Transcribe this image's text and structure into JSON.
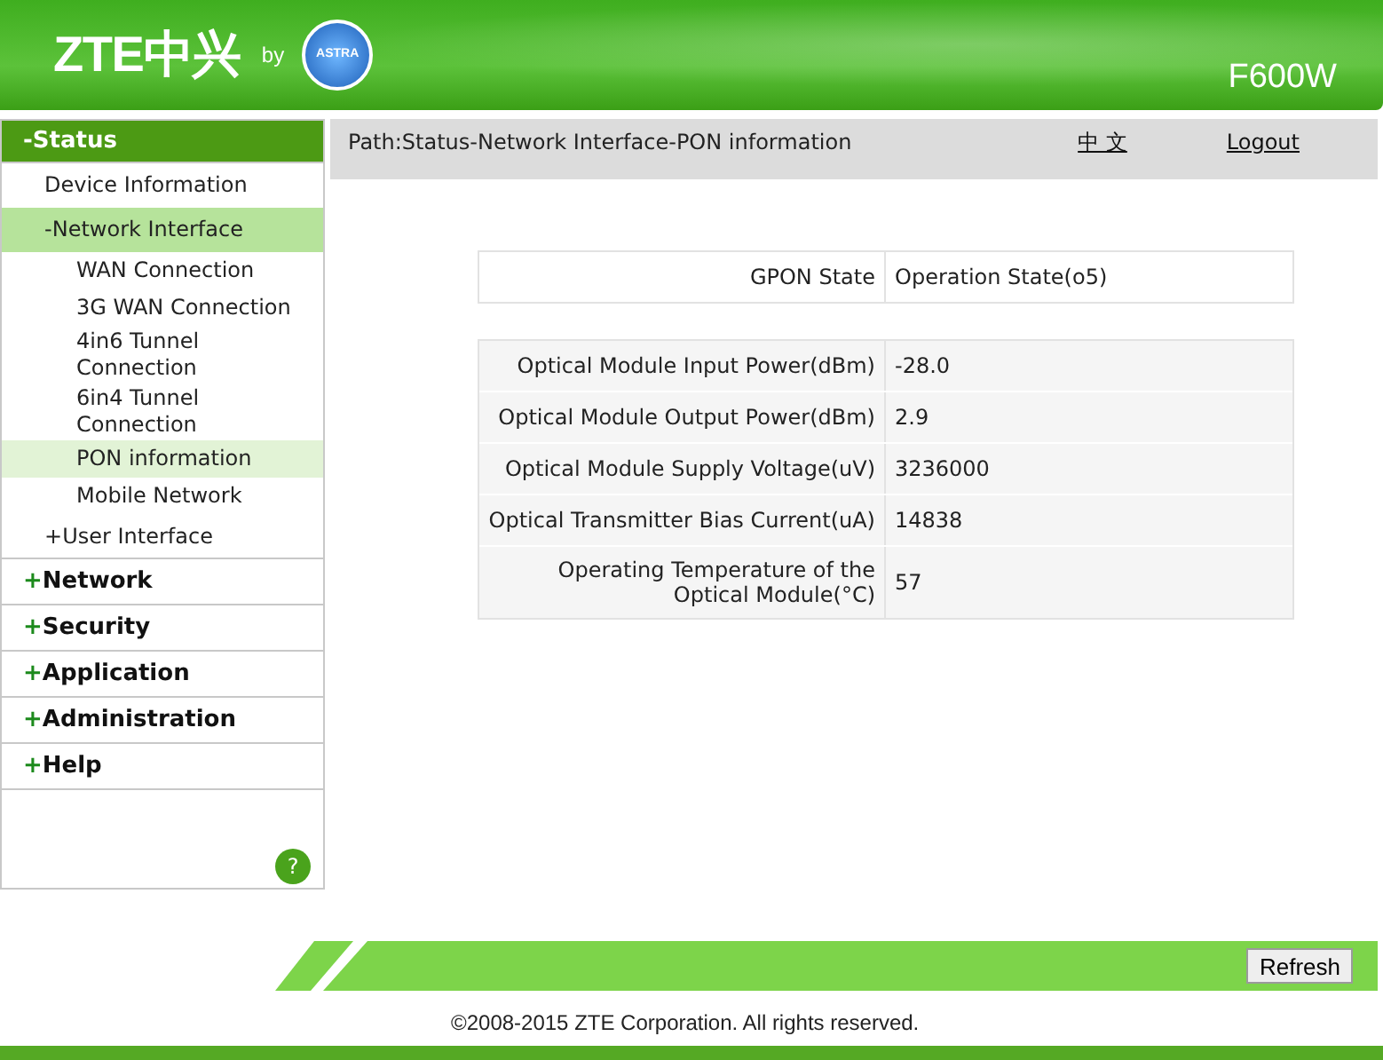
{
  "header": {
    "brand": "ZTE中兴",
    "by": "by",
    "partner_logo": "ASTRA",
    "model": "F600W"
  },
  "sidebar": {
    "items": [
      {
        "marker": "-",
        "label": "Status",
        "expanded": true,
        "children": [
          {
            "label": "Device Information",
            "selected": false
          },
          {
            "marker": "-",
            "label": "Network Interface",
            "expanded": true,
            "selected": false,
            "children": [
              {
                "label": "WAN Connection",
                "selected": false
              },
              {
                "label": "3G WAN Connection",
                "selected": false
              },
              {
                "label": "4in6 Tunnel Connection",
                "selected": false
              },
              {
                "label": "6in4 Tunnel Connection",
                "selected": false
              },
              {
                "label": "PON information",
                "selected": true
              },
              {
                "label": "Mobile Network",
                "selected": false
              }
            ]
          },
          {
            "marker": "+",
            "label": "User Interface",
            "expanded": false,
            "selected": false
          }
        ]
      },
      {
        "marker": "+",
        "label": "Network",
        "expanded": false
      },
      {
        "marker": "+",
        "label": "Security",
        "expanded": false
      },
      {
        "marker": "+",
        "label": "Application",
        "expanded": false
      },
      {
        "marker": "+",
        "label": "Administration",
        "expanded": false
      },
      {
        "marker": "+",
        "label": "Help",
        "expanded": false
      }
    ],
    "help_button": "?"
  },
  "path_bar": {
    "path": "Path:Status-Network Interface-PON information",
    "language_link": "中 文",
    "logout_link": "Logout"
  },
  "state_table": [
    {
      "label": "GPON State",
      "value": "Operation State(o5)"
    }
  ],
  "optical_table": [
    {
      "label": "Optical Module Input Power(dBm)",
      "value": "-28.0"
    },
    {
      "label": "Optical Module Output Power(dBm)",
      "value": "2.9"
    },
    {
      "label": "Optical Module Supply Voltage(uV)",
      "value": "3236000"
    },
    {
      "label": "Optical Transmitter Bias Current(uA)",
      "value": "14838"
    },
    {
      "label": "Operating Temperature of the Optical Module(°C)",
      "value": "57"
    }
  ],
  "refresh_button": "Refresh",
  "copyright": "©2008-2015 ZTE Corporation. All rights reserved."
}
